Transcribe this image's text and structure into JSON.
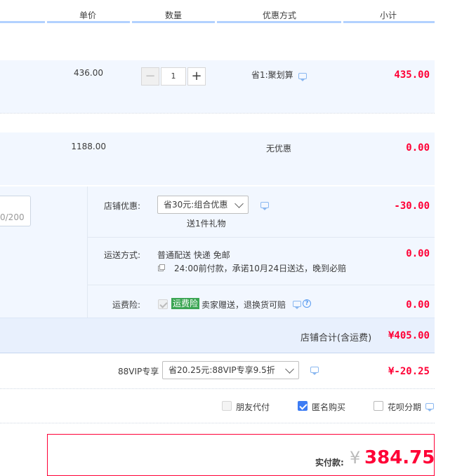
{
  "header": {
    "unit_price": "单价",
    "quantity": "数量",
    "discount": "优惠方式",
    "subtotal": "小计"
  },
  "items": [
    {
      "price": "436.00",
      "quantity": "1",
      "promo": "省1:聚划算",
      "subtotal": "435.00"
    },
    {
      "price": "1188.00",
      "promo": "无优惠",
      "subtotal": "0.00"
    }
  ],
  "shop": {
    "note_counter": "0/200",
    "shop_discount_label": "店铺优惠:",
    "shop_discount_value": "省30元:组合优惠",
    "gift_text": "送1件礼物",
    "shop_discount_amount": "-30.00",
    "shipping_label": "运送方式:",
    "shipping_method": "普通配送 快递 免邮",
    "shipping_promise": "24:00前付款，承诺10月24日送达，晚到必赔",
    "shipping_amount": "0.00",
    "insurance_label": "运费险:",
    "insurance_badge": "运费险",
    "insurance_text": "卖家赠送，退换货可赔",
    "insurance_amount": "0.00",
    "shop_total_label": "店铺合计(含运费)",
    "shop_total_value": "¥405.00"
  },
  "vip": {
    "label": "88VIP专享",
    "select_value": "省20.25元:88VIP专享9.5折",
    "amount": "¥-20.25"
  },
  "options": {
    "friend_pay": "朋友代付",
    "anonymous": "匿名购买",
    "huabei": "花呗分期"
  },
  "payment": {
    "label": "实付款:",
    "currency": "¥",
    "amount": "384.75"
  },
  "colors": {
    "accent_red": "#ff0036",
    "badge_green": "#3ba553",
    "checkbox_blue": "#3d7cf4"
  }
}
